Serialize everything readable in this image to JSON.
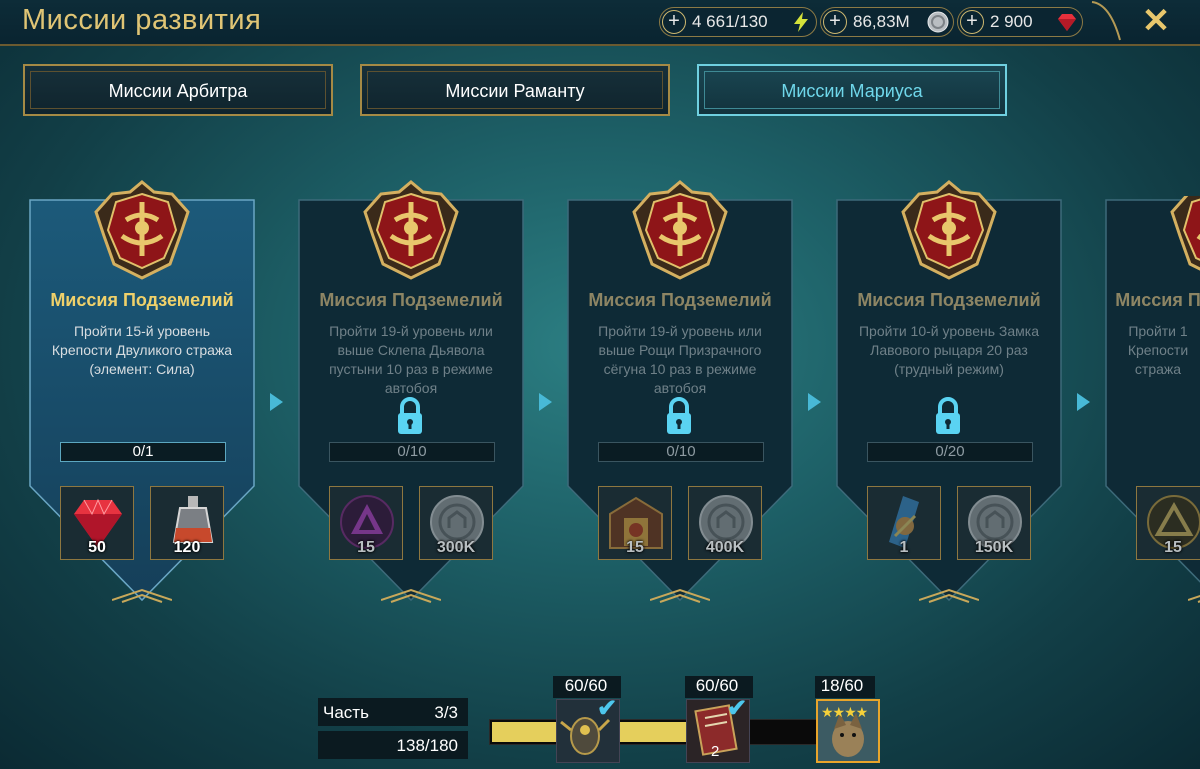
{
  "header": {
    "title": "Миссии развития",
    "resources": [
      {
        "name": "energy",
        "value": "4 661/130",
        "icon": "lightning-icon"
      },
      {
        "name": "silver",
        "value": "86,83M",
        "icon": "silver-coin-icon"
      },
      {
        "name": "gems",
        "value": "2 900",
        "icon": "ruby-gem-icon"
      }
    ]
  },
  "tabs": [
    {
      "label": "Миссии Арбитра",
      "active": false
    },
    {
      "label": "Миссии Раманту",
      "active": false
    },
    {
      "label": "Миссии Мариуса",
      "active": true
    }
  ],
  "missions": [
    {
      "title": "Миссия Подземелий",
      "description": "Пройти 15-й уровень Крепости Двуликого стража (элемент: Сила)",
      "progress": "0/1",
      "locked": false,
      "rewards": [
        {
          "icon": "ruby-gem-icon",
          "qty": "50"
        },
        {
          "icon": "potion-flask-icon",
          "qty": "120"
        }
      ]
    },
    {
      "title": "Миссия Подземелий",
      "description": "Пройти 19-й уровень или выше Склепа Дьявола пустыни 10 раз в режиме автобоя",
      "progress": "0/10",
      "locked": true,
      "rewards": [
        {
          "icon": "void-shard-icon",
          "qty": "15"
        },
        {
          "icon": "silver-coin-icon",
          "qty": "300K"
        }
      ]
    },
    {
      "title": "Миссия Подземелий",
      "description": "Пройти 19-й уровень или выше Рощи Призрачного сёгуна 10 раз в режиме автобоя",
      "progress": "0/10",
      "locked": true,
      "rewards": [
        {
          "icon": "shrine-gate-icon",
          "qty": "15"
        },
        {
          "icon": "silver-coin-icon",
          "qty": "400K"
        }
      ]
    },
    {
      "title": "Миссия Подземелий",
      "description": "Пройти 10-й уровень Замка Лавового рыцаря 20 раз (трудный режим)",
      "progress": "0/20",
      "locked": true,
      "rewards": [
        {
          "icon": "hero-chest-icon",
          "qty": "1"
        },
        {
          "icon": "silver-coin-icon",
          "qty": "150K"
        }
      ]
    },
    {
      "title": "Миссия П",
      "description": "Пройти 1 Крепости стража",
      "progress": "",
      "locked": false,
      "rewards": [
        {
          "icon": "ancient-shard-icon",
          "qty": "15"
        }
      ]
    }
  ],
  "footer": {
    "part_label": "Часть",
    "part_value": "3/3",
    "points": "138/180",
    "progress_fraction": 0.77,
    "chests": [
      {
        "count": "60/60",
        "claimed": true,
        "qty": ""
      },
      {
        "count": "60/60",
        "claimed": true,
        "qty": "2"
      },
      {
        "count": "18/60",
        "claimed": false,
        "qty": ""
      }
    ]
  },
  "colors": {
    "accent_gold": "#e0c575",
    "accent_cyan": "#6fd7ea",
    "progress_yellow": "#e5cf5c"
  }
}
